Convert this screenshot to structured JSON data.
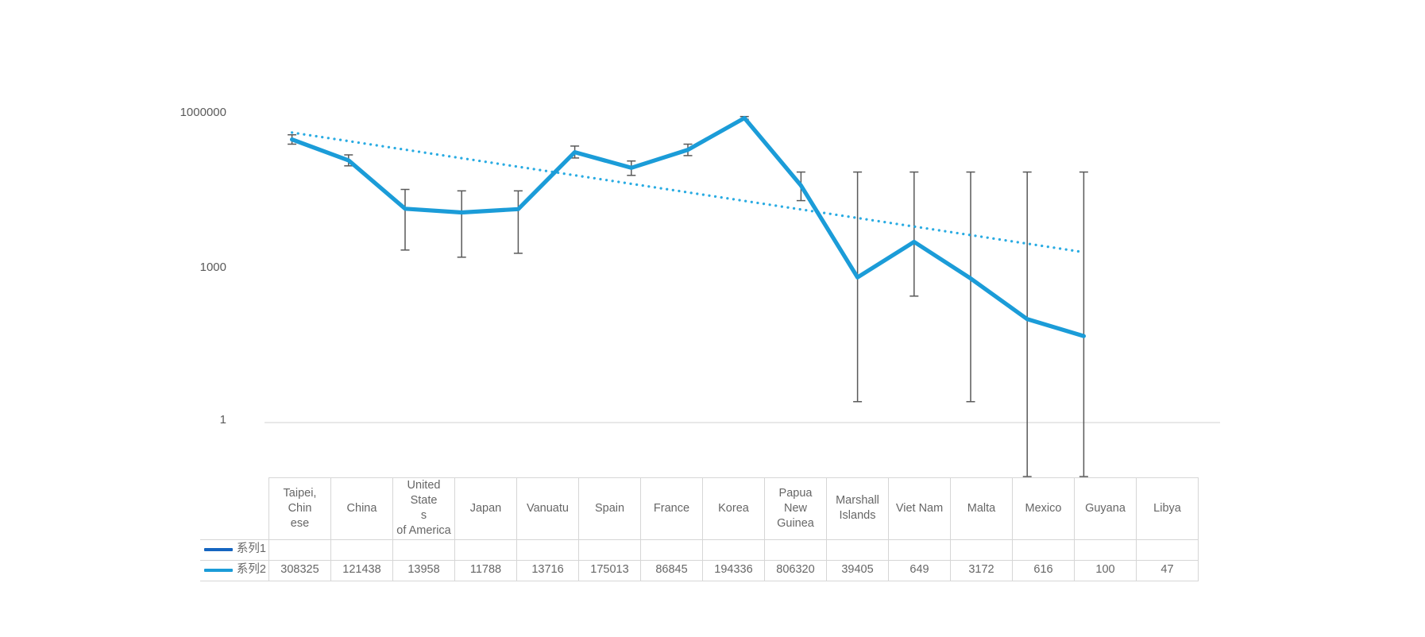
{
  "chart_data": {
    "type": "line",
    "title": "",
    "xlabel": "",
    "ylabel": "",
    "yscale": "log",
    "ylim": [
      1,
      1000000
    ],
    "ytick_labels": [
      "1000000",
      "1000",
      "1"
    ],
    "ytick_values": [
      1000000,
      1000,
      1
    ],
    "grid": false,
    "legend_position": "table-left",
    "categories": [
      "Taipei, Chinese",
      "China",
      "United States of America",
      "Japan",
      "Vanuatu",
      "Spain",
      "France",
      "Korea",
      "Papua New Guinea",
      "Marshall Islands",
      "Viet Nam",
      "Malta",
      "Mexico",
      "Guyana",
      "Libya"
    ],
    "series": [
      {
        "name": "系列1",
        "color": "#1565C0",
        "style": "solid",
        "values": []
      },
      {
        "name": "系列2",
        "color": "#1B9CD8",
        "style": "solid",
        "values": [
          308325,
          121438,
          13958,
          11788,
          13716,
          175013,
          86845,
          194336,
          806320,
          39405,
          649,
          3172,
          616,
          100,
          47
        ]
      }
    ],
    "trendline": {
      "name": "trendline",
      "color": "#29ABE2",
      "style": "dotted",
      "start_value": 420000,
      "end_value": 2000
    },
    "error_bars": {
      "color": "#595959",
      "upper": [
        380000,
        155000,
        33000,
        31000,
        31000,
        230000,
        118000,
        250000,
        860000,
        72000,
        72000,
        72000,
        72000,
        72000,
        72000
      ],
      "lower": [
        250000,
        95000,
        2200,
        1600,
        1900,
        135000,
        62000,
        150000,
        760000,
        20000,
        2.5,
        280,
        2.5,
        1.0,
        1.0
      ]
    }
  },
  "table": {
    "header_row": [
      "Taipei, Chinese",
      "China",
      "United States of America",
      "Japan",
      "Vanuatu",
      "Spain",
      "France",
      "Korea",
      "Papua New Guinea",
      "Marshall Islands",
      "Viet Nam",
      "Malta",
      "Mexico",
      "Guyana",
      "Libya"
    ],
    "header_display": [
      "Taipei, Chin\nese",
      "China",
      "United State\ns\nof America",
      "Japan",
      "Vanuatu",
      "Spain",
      "France",
      "Korea",
      "Papua New\nGuinea",
      "Marshall\nIslands",
      "Viet Nam",
      "Malta",
      "Mexico",
      "Guyana",
      "Libya"
    ],
    "rows": [
      {
        "label": "系列1",
        "color": "#1565C0",
        "values": [
          "",
          "",
          "",
          "",
          "",
          "",
          "",
          "",
          "",
          "",
          "",
          "",
          "",
          "",
          ""
        ]
      },
      {
        "label": "系列2",
        "color": "#1B9CD8",
        "values": [
          "308325",
          "121438",
          "13958",
          "11788",
          "13716",
          "175013",
          "86845",
          "194336",
          "806320",
          "39405",
          "649",
          "3172",
          "616",
          "100",
          "47"
        ]
      }
    ]
  },
  "colors": {
    "series1": "#1565C0",
    "series2": "#1B9CD8",
    "trendline": "#29ABE2",
    "error_bar": "#595959",
    "axis_line": "#d9d9d9",
    "grid_border": "#d6d6d6",
    "text": "#666666"
  }
}
